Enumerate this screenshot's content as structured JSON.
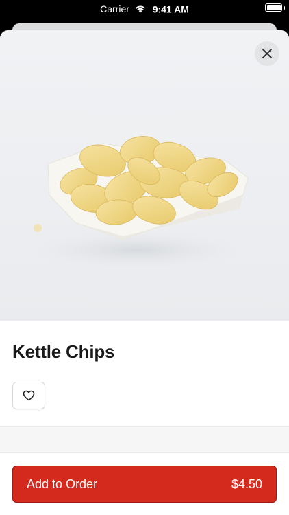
{
  "status_bar": {
    "carrier": "Carrier",
    "time": "9:41 AM"
  },
  "icons": {
    "close": "close-icon",
    "favorite": "heart-icon",
    "wifi": "wifi-icon",
    "battery": "battery-icon"
  },
  "product": {
    "title": "Kettle Chips"
  },
  "cta": {
    "label": "Add to Order",
    "price": "$4.50"
  },
  "colors": {
    "accent": "#d42a1e",
    "accent_border": "#9e1a12"
  }
}
